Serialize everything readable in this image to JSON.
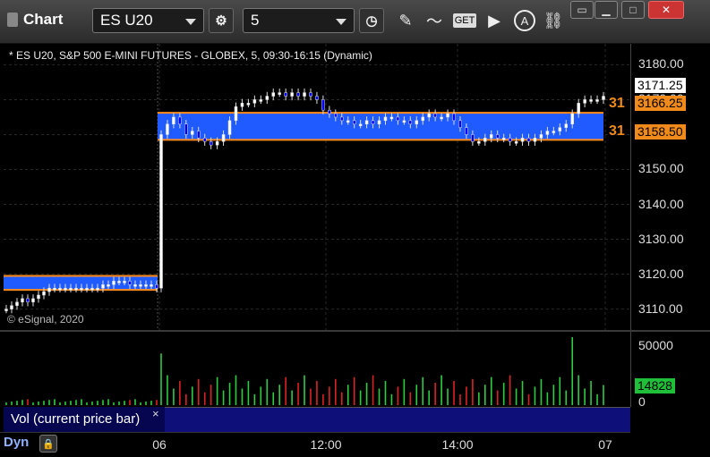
{
  "window": {
    "title": "Chart"
  },
  "toolbar": {
    "symbol": "ES U20",
    "interval": "5",
    "buttons": [
      "settings-icon",
      "clock-icon",
      "pencil-icon",
      "study-icon",
      "get-icon",
      "play-icon",
      "alert-icon",
      "link-icon"
    ],
    "get_label": "GET",
    "alert_label": "A"
  },
  "window_controls": [
    "restore-icon",
    "minimize-icon",
    "maximize-icon",
    "close-icon"
  ],
  "chart": {
    "info": "* ES U20, S&P 500 E-MINI FUTURES - GLOBEX, 5, 09:30-16:15 (Dynamic)",
    "copyright": "© eSignal, 2020",
    "last_price": "3171.25",
    "upper_level": "3166.25",
    "lower_level": "3158.50",
    "level_prefix": "31",
    "y_ticks": [
      "3180.00",
      "3170.00",
      "3160.00",
      "3150.00",
      "3140.00",
      "3130.00",
      "3120.00",
      "3110.00"
    ],
    "vol_ticks": [
      "50000",
      "0"
    ],
    "vol_last": "14828",
    "x_ticks": [
      "06",
      "12:00",
      "14:00",
      "07"
    ],
    "study_label": "Vol (current price bar)",
    "study_close": "×",
    "dyn_label": "Dyn"
  },
  "colors": {
    "band": "#1f5bff",
    "band_line": "#ff8c1a",
    "up": "#ffffff",
    "down": "#0000ff",
    "vol_up": "#2ecc40",
    "vol_down": "#d22"
  },
  "chart_data": {
    "type": "candlestick",
    "ylim": [
      3104,
      3186
    ],
    "y_ticks": [
      3180,
      3170,
      3160,
      3150,
      3140,
      3130,
      3120,
      3110
    ],
    "bands": [
      {
        "session": "previous",
        "from": 3115.5,
        "to": 3119.5
      },
      {
        "session": "current",
        "from": 3158.5,
        "to": 3166.25
      }
    ],
    "closes": [
      3110,
      3111,
      3112,
      3113,
      3112,
      3113,
      3114,
      3115,
      3116,
      3116,
      3116,
      3116,
      3116,
      3116,
      3116,
      3116,
      3116,
      3116,
      3117,
      3117,
      3118,
      3118,
      3118,
      3117,
      3117,
      3117,
      3117,
      3117,
      3116,
      3160,
      3163,
      3165,
      3163,
      3160,
      3161,
      3159,
      3158,
      3157,
      3158,
      3160,
      3164,
      3168,
      3169,
      3169,
      3170,
      3170,
      3171,
      3172,
      3172,
      3171,
      3172,
      3171,
      3172,
      3171,
      3170,
      3167,
      3166,
      3165,
      3164,
      3164,
      3163,
      3163,
      3164,
      3163,
      3164,
      3165,
      3165,
      3164,
      3164,
      3163,
      3164,
      3165,
      3166,
      3165,
      3165,
      3166,
      3164,
      3162,
      3160,
      3158,
      3158,
      3159,
      3160,
      3159,
      3159,
      3158,
      3158,
      3159,
      3158,
      3159,
      3160,
      3161,
      3161,
      3162,
      3163,
      3166,
      3169,
      3170,
      3170,
      3170,
      3171
    ],
    "volume_max": 50000,
    "volume_last": 14828
  }
}
